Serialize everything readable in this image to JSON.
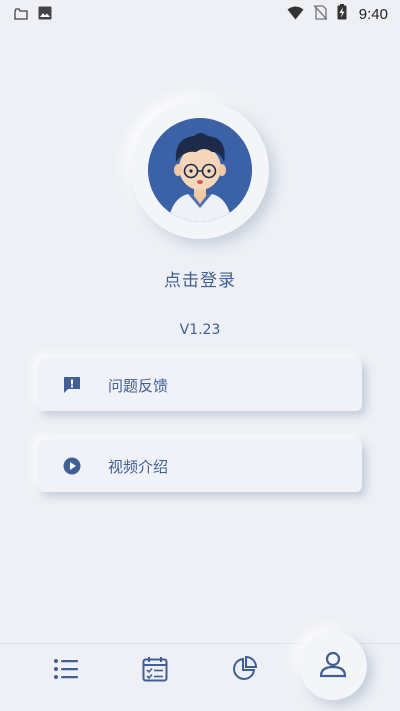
{
  "status_bar": {
    "time": "9:40",
    "left_icons": [
      "folder-icon",
      "image-icon"
    ],
    "right_icons": [
      "wifi-icon",
      "no-sim-icon",
      "battery-charging-icon"
    ]
  },
  "profile": {
    "login_label": "点击登录",
    "version": "V1.23"
  },
  "menu": {
    "items": [
      {
        "label": "问题反馈",
        "icon": "feedback-icon"
      },
      {
        "label": "视频介绍",
        "icon": "play-circle-icon"
      }
    ]
  },
  "bottom_nav": {
    "items": [
      {
        "icon": "list-icon",
        "active": false
      },
      {
        "icon": "calendar-icon",
        "active": false
      },
      {
        "icon": "pie-chart-icon",
        "active": false
      },
      {
        "icon": "user-icon",
        "active": true
      }
    ]
  },
  "colors": {
    "background": "#eef0f5",
    "accent": "#3f5f95",
    "avatar_bg": "#3b62a6"
  }
}
